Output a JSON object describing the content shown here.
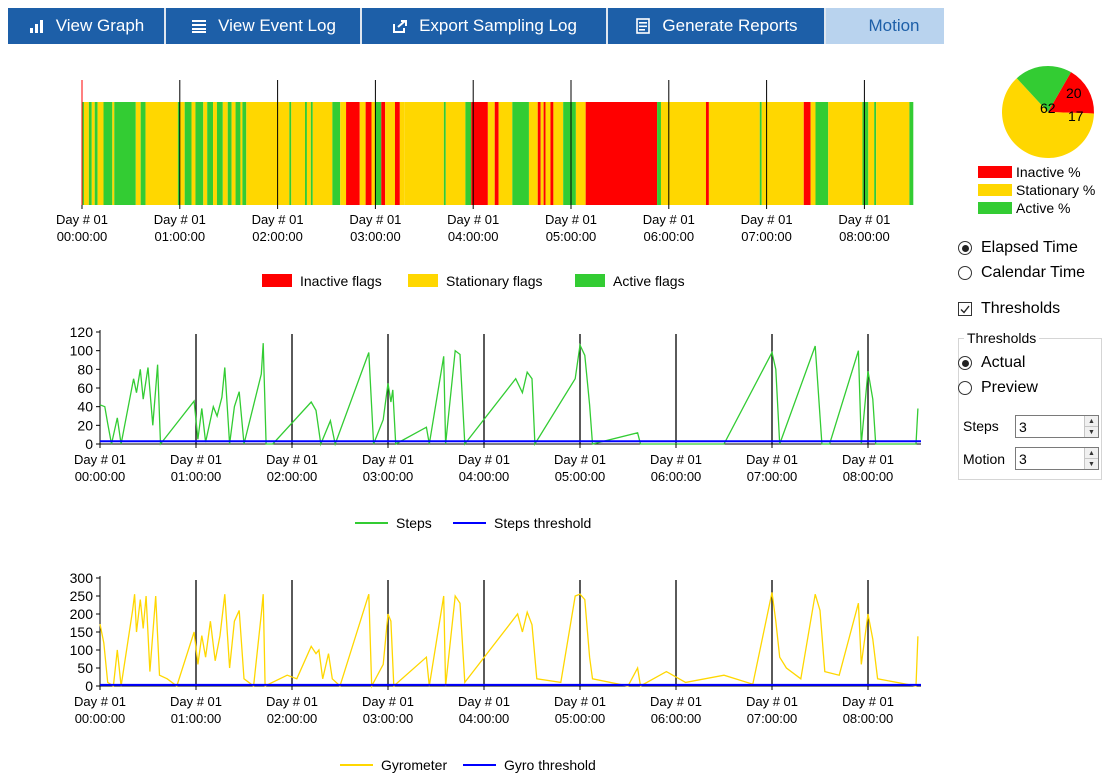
{
  "toolbar": {
    "view_graph": "View Graph",
    "view_event_log": "View Event Log",
    "export_sampling_log": "Export Sampling Log",
    "generate_reports": "Generate Reports",
    "motion": "Motion"
  },
  "time_axis_labels": [
    [
      "Day # 01",
      "00:00:00"
    ],
    [
      "Day # 01",
      "01:00:00"
    ],
    [
      "Day # 01",
      "02:00:00"
    ],
    [
      "Day # 01",
      "03:00:00"
    ],
    [
      "Day # 01",
      "04:00:00"
    ],
    [
      "Day # 01",
      "05:00:00"
    ],
    [
      "Day # 01",
      "06:00:00"
    ],
    [
      "Day # 01",
      "07:00:00"
    ],
    [
      "Day # 01",
      "08:00:00"
    ]
  ],
  "flags_chart": {
    "legend": [
      "Inactive flags",
      "Stationary flags",
      "Active flags"
    ],
    "colors": {
      "inactive": "#ff0000",
      "stationary": "#ffd700",
      "active": "#33cc33"
    },
    "segments": [
      [
        0.0,
        0.02,
        "g"
      ],
      [
        0.02,
        0.07,
        "y"
      ],
      [
        0.07,
        0.1,
        "g"
      ],
      [
        0.1,
        0.13,
        "y"
      ],
      [
        0.13,
        0.16,
        "g"
      ],
      [
        0.16,
        0.22,
        "y"
      ],
      [
        0.22,
        0.31,
        "g"
      ],
      [
        0.31,
        0.33,
        "y"
      ],
      [
        0.33,
        0.55,
        "g"
      ],
      [
        0.55,
        0.6,
        "y"
      ],
      [
        0.6,
        0.65,
        "g"
      ],
      [
        0.65,
        0.98,
        "y"
      ],
      [
        0.98,
        1.0,
        "g"
      ],
      [
        1.0,
        1.05,
        "y"
      ],
      [
        1.05,
        1.12,
        "g"
      ],
      [
        1.12,
        1.16,
        "y"
      ],
      [
        1.16,
        1.24,
        "g"
      ],
      [
        1.24,
        1.28,
        "y"
      ],
      [
        1.28,
        1.34,
        "g"
      ],
      [
        1.34,
        1.38,
        "y"
      ],
      [
        1.38,
        1.44,
        "g"
      ],
      [
        1.44,
        1.49,
        "y"
      ],
      [
        1.49,
        1.53,
        "g"
      ],
      [
        1.53,
        1.57,
        "y"
      ],
      [
        1.57,
        1.62,
        "g"
      ],
      [
        1.62,
        1.64,
        "y"
      ],
      [
        1.64,
        1.68,
        "g"
      ],
      [
        1.68,
        2.12,
        "y"
      ],
      [
        2.12,
        2.14,
        "g"
      ],
      [
        2.14,
        2.28,
        "y"
      ],
      [
        2.28,
        2.3,
        "g"
      ],
      [
        2.3,
        2.34,
        "y"
      ],
      [
        2.34,
        2.36,
        "g"
      ],
      [
        2.36,
        2.56,
        "y"
      ],
      [
        2.56,
        2.64,
        "g"
      ],
      [
        2.64,
        2.7,
        "y"
      ],
      [
        2.7,
        2.84,
        "r"
      ],
      [
        2.84,
        2.9,
        "y"
      ],
      [
        2.9,
        2.96,
        "r"
      ],
      [
        2.96,
        3.0,
        "y"
      ],
      [
        3.0,
        3.06,
        "g"
      ],
      [
        3.06,
        3.1,
        "r"
      ],
      [
        3.1,
        3.2,
        "y"
      ],
      [
        3.2,
        3.25,
        "r"
      ],
      [
        3.25,
        3.3,
        "y"
      ],
      [
        3.3,
        3.7,
        "y"
      ],
      [
        3.7,
        3.72,
        "g"
      ],
      [
        3.72,
        3.92,
        "y"
      ],
      [
        3.92,
        3.98,
        "g"
      ],
      [
        3.98,
        4.15,
        "r"
      ],
      [
        4.15,
        4.22,
        "y"
      ],
      [
        4.22,
        4.26,
        "r"
      ],
      [
        4.26,
        4.4,
        "y"
      ],
      [
        4.4,
        4.57,
        "g"
      ],
      [
        4.57,
        4.66,
        "y"
      ],
      [
        4.66,
        4.69,
        "r"
      ],
      [
        4.69,
        4.72,
        "y"
      ],
      [
        4.72,
        4.74,
        "r"
      ],
      [
        4.74,
        4.79,
        "y"
      ],
      [
        4.79,
        4.82,
        "r"
      ],
      [
        4.82,
        4.92,
        "y"
      ],
      [
        4.92,
        5.05,
        "g"
      ],
      [
        5.05,
        5.15,
        "y"
      ],
      [
        5.15,
        5.88,
        "r"
      ],
      [
        5.88,
        5.92,
        "g"
      ],
      [
        5.92,
        6.38,
        "y"
      ],
      [
        6.38,
        6.41,
        "r"
      ],
      [
        6.41,
        6.93,
        "y"
      ],
      [
        6.93,
        6.95,
        "g"
      ],
      [
        6.95,
        7.38,
        "y"
      ],
      [
        7.38,
        7.45,
        "r"
      ],
      [
        7.45,
        7.5,
        "y"
      ],
      [
        7.5,
        7.63,
        "g"
      ],
      [
        7.63,
        7.98,
        "y"
      ],
      [
        7.98,
        8.04,
        "g"
      ],
      [
        8.04,
        8.1,
        "y"
      ],
      [
        8.1,
        8.12,
        "g"
      ],
      [
        8.12,
        8.46,
        "y"
      ],
      [
        8.46,
        8.5,
        "g"
      ]
    ]
  },
  "pie": {
    "values": [
      17,
      62,
      20
    ],
    "labels": [
      "17",
      "62",
      "20"
    ],
    "colors": [
      "#ff0000",
      "#ffd700",
      "#33cc33"
    ]
  },
  "pie_legend": [
    "Inactive %",
    "Stationary %",
    "Active %"
  ],
  "options": {
    "elapsed_time": "Elapsed Time",
    "calendar_time": "Calendar Time",
    "thresholds_check": "Thresholds",
    "thresholds_group": "Thresholds",
    "actual": "Actual",
    "preview": "Preview",
    "steps_label": "Steps",
    "steps_value": "3",
    "motion_label": "Motion",
    "motion_value": "3"
  },
  "chart_data": [
    {
      "type": "line",
      "ylim": [
        0,
        120
      ],
      "yticks": [
        0,
        20,
        40,
        60,
        80,
        100,
        120
      ],
      "legend": [
        "Steps",
        "Steps threshold"
      ],
      "series": [
        {
          "name": "Steps",
          "color": "#33cc33",
          "points": [
            [
              0,
              42
            ],
            [
              0.05,
              40
            ],
            [
              0.08,
              22
            ],
            [
              0.12,
              0
            ],
            [
              0.18,
              28
            ],
            [
              0.22,
              0
            ],
            [
              0.35,
              70
            ],
            [
              0.38,
              55
            ],
            [
              0.42,
              80
            ],
            [
              0.45,
              48
            ],
            [
              0.5,
              82
            ],
            [
              0.55,
              20
            ],
            [
              0.6,
              85
            ],
            [
              0.63,
              0
            ],
            [
              0.98,
              46
            ],
            [
              1.02,
              5
            ],
            [
              1.06,
              38
            ],
            [
              1.1,
              2
            ],
            [
              1.18,
              40
            ],
            [
              1.22,
              30
            ],
            [
              1.27,
              50
            ],
            [
              1.3,
              82
            ],
            [
              1.35,
              0
            ],
            [
              1.4,
              40
            ],
            [
              1.45,
              56
            ],
            [
              1.5,
              0
            ],
            [
              1.68,
              75
            ],
            [
              1.7,
              108
            ],
            [
              1.73,
              0
            ],
            [
              1.8,
              0
            ],
            [
              2.2,
              45
            ],
            [
              2.25,
              36
            ],
            [
              2.3,
              0
            ],
            [
              2.4,
              25
            ],
            [
              2.45,
              0
            ],
            [
              2.8,
              98
            ],
            [
              2.85,
              0
            ],
            [
              2.95,
              26
            ],
            [
              3.0,
              65
            ],
            [
              3.03,
              45
            ],
            [
              3.05,
              58
            ],
            [
              3.08,
              0
            ],
            [
              3.4,
              18
            ],
            [
              3.43,
              0
            ],
            [
              3.58,
              94
            ],
            [
              3.6,
              0
            ],
            [
              3.7,
              100
            ],
            [
              3.75,
              96
            ],
            [
              3.8,
              0
            ],
            [
              4.33,
              70
            ],
            [
              4.4,
              55
            ],
            [
              4.45,
              77
            ],
            [
              4.5,
              70
            ],
            [
              4.53,
              0
            ],
            [
              4.95,
              70
            ],
            [
              5.0,
              106
            ],
            [
              5.05,
              95
            ],
            [
              5.1,
              42
            ],
            [
              5.13,
              0
            ],
            [
              5.6,
              12
            ],
            [
              5.63,
              0
            ],
            [
              6.5,
              0
            ],
            [
              7.0,
              98
            ],
            [
              7.04,
              80
            ],
            [
              7.08,
              0
            ],
            [
              7.45,
              105
            ],
            [
              7.52,
              0
            ],
            [
              7.6,
              0
            ],
            [
              7.9,
              100
            ],
            [
              7.93,
              0
            ],
            [
              8.0,
              78
            ],
            [
              8.05,
              48
            ],
            [
              8.08,
              0
            ],
            [
              8.5,
              0
            ],
            [
              8.52,
              38
            ]
          ]
        },
        {
          "name": "Steps threshold",
          "color": "#0000ff",
          "value": 3
        }
      ]
    },
    {
      "type": "line",
      "ylim": [
        0,
        300
      ],
      "yticks": [
        0,
        50,
        100,
        150,
        200,
        250,
        300
      ],
      "legend": [
        "Gyrometer",
        "Gyro threshold"
      ],
      "series": [
        {
          "name": "Gyrometer",
          "color": "#ffd700",
          "points": [
            [
              0,
              172
            ],
            [
              0.04,
              120
            ],
            [
              0.08,
              10
            ],
            [
              0.14,
              0
            ],
            [
              0.18,
              100
            ],
            [
              0.22,
              0
            ],
            [
              0.34,
              210
            ],
            [
              0.36,
              255
            ],
            [
              0.38,
              150
            ],
            [
              0.42,
              240
            ],
            [
              0.45,
              160
            ],
            [
              0.48,
              250
            ],
            [
              0.52,
              40
            ],
            [
              0.58,
              250
            ],
            [
              0.62,
              30
            ],
            [
              0.7,
              20
            ],
            [
              0.8,
              0
            ],
            [
              0.98,
              150
            ],
            [
              1.02,
              60
            ],
            [
              1.06,
              140
            ],
            [
              1.1,
              80
            ],
            [
              1.15,
              180
            ],
            [
              1.2,
              70
            ],
            [
              1.25,
              140
            ],
            [
              1.3,
              255
            ],
            [
              1.35,
              50
            ],
            [
              1.4,
              180
            ],
            [
              1.45,
              210
            ],
            [
              1.5,
              20
            ],
            [
              1.6,
              0
            ],
            [
              1.68,
              200
            ],
            [
              1.7,
              255
            ],
            [
              1.72,
              0
            ],
            [
              1.95,
              30
            ],
            [
              2.05,
              20
            ],
            [
              2.2,
              110
            ],
            [
              2.25,
              90
            ],
            [
              2.28,
              100
            ],
            [
              2.32,
              20
            ],
            [
              2.38,
              90
            ],
            [
              2.42,
              20
            ],
            [
              2.5,
              0
            ],
            [
              2.8,
              255
            ],
            [
              2.83,
              0
            ],
            [
              2.95,
              60
            ],
            [
              3.0,
              200
            ],
            [
              3.03,
              180
            ],
            [
              3.06,
              0
            ],
            [
              3.4,
              80
            ],
            [
              3.43,
              0
            ],
            [
              3.58,
              250
            ],
            [
              3.6,
              0
            ],
            [
              3.7,
              250
            ],
            [
              3.75,
              230
            ],
            [
              3.8,
              10
            ],
            [
              4.35,
              200
            ],
            [
              4.4,
              150
            ],
            [
              4.45,
              205
            ],
            [
              4.5,
              170
            ],
            [
              4.55,
              20
            ],
            [
              4.8,
              10
            ],
            [
              4.95,
              250
            ],
            [
              5.0,
              255
            ],
            [
              5.05,
              240
            ],
            [
              5.1,
              80
            ],
            [
              5.13,
              20
            ],
            [
              5.5,
              0
            ],
            [
              5.6,
              50
            ],
            [
              5.63,
              0
            ],
            [
              5.9,
              40
            ],
            [
              6.1,
              10
            ],
            [
              6.5,
              30
            ],
            [
              6.8,
              5
            ],
            [
              7.0,
              260
            ],
            [
              7.04,
              180
            ],
            [
              7.08,
              80
            ],
            [
              7.15,
              50
            ],
            [
              7.3,
              20
            ],
            [
              7.45,
              255
            ],
            [
              7.5,
              210
            ],
            [
              7.55,
              40
            ],
            [
              7.7,
              30
            ],
            [
              7.9,
              230
            ],
            [
              7.93,
              60
            ],
            [
              8.0,
              200
            ],
            [
              8.05,
              130
            ],
            [
              8.1,
              20
            ],
            [
              8.5,
              0
            ],
            [
              8.52,
              138
            ]
          ]
        },
        {
          "name": "Gyro threshold",
          "color": "#0000ff",
          "value": 3
        }
      ]
    }
  ]
}
